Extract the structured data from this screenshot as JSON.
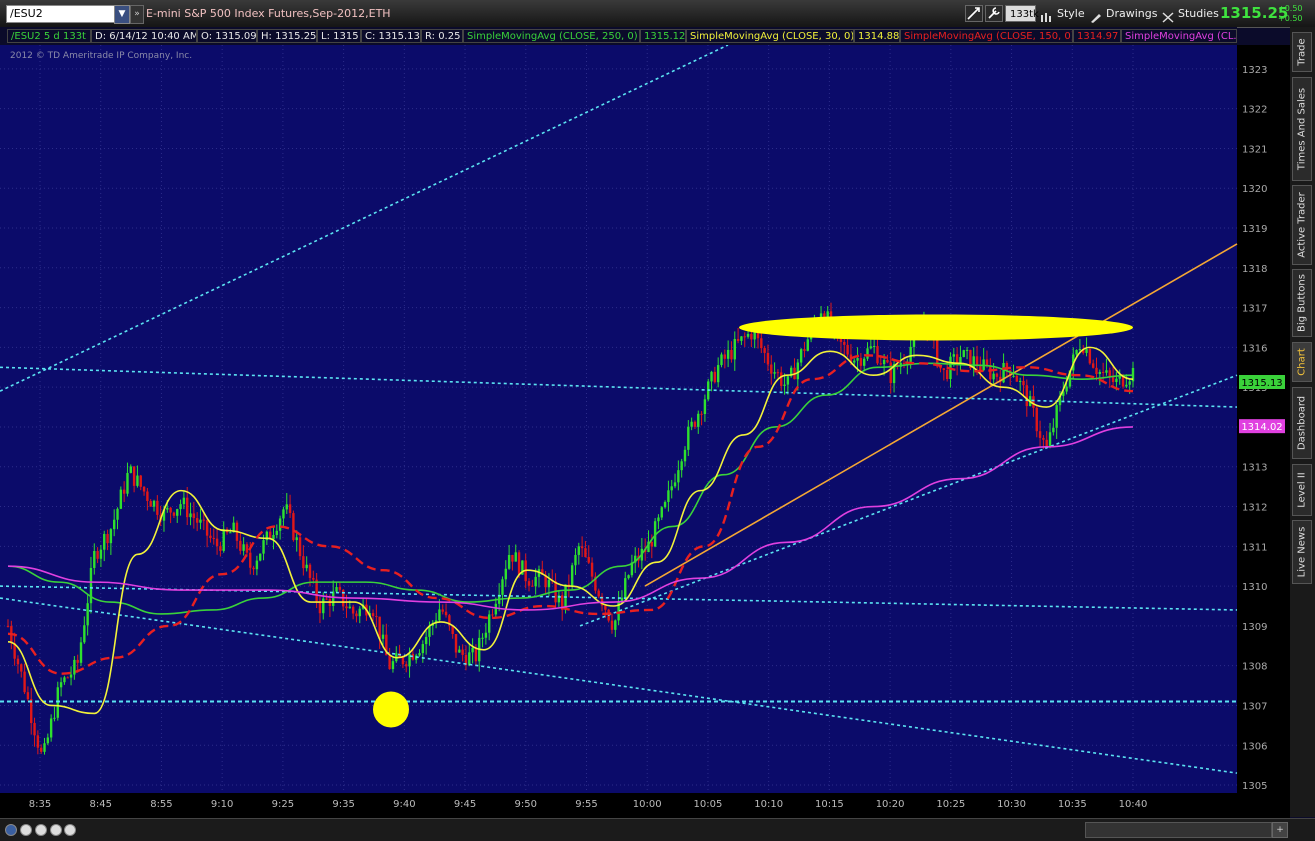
{
  "header": {
    "symbol": "/ESU2",
    "description": "E-mini S&P 500 Index Futures,Sep-2012,ETH",
    "aggregation_badge": "133tk",
    "style_label": "Style",
    "drawings_label": "Drawings",
    "studies_label": "Studies",
    "last_price": "1315.25",
    "change_top": "+0.50",
    "change_bottom": "+0.50"
  },
  "info_bar": {
    "aggregation": "/ESU2 5 d 133t",
    "datetime": "D: 6/14/12 10:40 AM",
    "open": "O: 1315.09",
    "high": "H: 1315.25",
    "low": "L: 1315",
    "close": "C: 1315.13",
    "range": "R: 0.25",
    "studies": [
      {
        "label": "SimpleMovingAvg (CLOSE, 250, 0)",
        "value": "1315.12",
        "color": "#3ad23a"
      },
      {
        "label": "SimpleMovingAvg (CLOSE, 30, 0)",
        "value": "1314.88",
        "color": "#f2f23a"
      },
      {
        "label": "SimpleMovingAvg (CLOSE, 150, 0)",
        "value": "1314.97",
        "color": "#e82020"
      },
      {
        "label": "SimpleMovingAvg (CL...",
        "value": "",
        "color": "#e040e0"
      }
    ]
  },
  "copyright": "2012 © TD Ameritrade IP Company, Inc.",
  "side_tabs": [
    "Trade",
    "Times And Sales",
    "Active Trader",
    "Big Buttons",
    "Chart",
    "Dashboard",
    "Level II",
    "Live News"
  ],
  "chart_data": {
    "type": "candlestick",
    "ylim": [
      1304.8,
      1323.6
    ],
    "yticks": [
      1305,
      1306,
      1307,
      1308,
      1309,
      1310,
      1311,
      1312,
      1313,
      1314,
      1315,
      1316,
      1317,
      1318,
      1319,
      1320,
      1321,
      1322,
      1323
    ],
    "xticks": [
      "8:35",
      "8:45",
      "8:55",
      "9:10",
      "9:25",
      "9:35",
      "9:40",
      "9:45",
      "9:50",
      "9:55",
      "10:00",
      "10:05",
      "10:10",
      "10:15",
      "10:20",
      "10:25",
      "10:30",
      "10:35",
      "10:40"
    ],
    "price_path": [
      1309,
      1307.4,
      1305.6,
      1307.5,
      1308,
      1310.8,
      1311.5,
      1312.9,
      1312.3,
      1311.8,
      1312.1,
      1311.6,
      1311,
      1311.4,
      1310.5,
      1311.2,
      1312,
      1310.7,
      1309.5,
      1309.8,
      1309.3,
      1309.6,
      1308,
      1308.2,
      1308.6,
      1309.5,
      1308.3,
      1308.2,
      1309.5,
      1310.9,
      1310.2,
      1310.2,
      1309.5,
      1311,
      1310,
      1309,
      1310.5,
      1311,
      1312,
      1313.5,
      1314.5,
      1315.5,
      1316,
      1316.4,
      1315.6,
      1315,
      1316,
      1317,
      1316.1,
      1315.7,
      1316,
      1315.3,
      1315.9,
      1316.7,
      1315.3,
      1315.8,
      1315.6,
      1315.3,
      1315.5,
      1314.6,
      1313.4,
      1315,
      1316.2,
      1315.4,
      1315.1,
      1315.4
    ],
    "series": [
      {
        "name": "SimpleMovingAvg (CLOSE, 250, 0)",
        "color": "#3ad23a",
        "style": "solid",
        "values": [
          1310.5,
          1310.1,
          1309.6,
          1309.3,
          1309.4,
          1309.7,
          1310.1,
          1310.1,
          1309.9,
          1309.6,
          1309.7,
          1309.9,
          1310.5,
          1311.5,
          1312.8,
          1314,
          1314.8,
          1315.5,
          1315.6,
          1315.55,
          1315.3,
          1315.2,
          1315.3
        ]
      },
      {
        "name": "SimpleMovingAvg (CLOSE, 30, 0)",
        "color": "#f2f23a",
        "style": "solid",
        "values": [
          1308.6,
          1307,
          1306.8,
          1310.8,
          1312.4,
          1311.4,
          1311.2,
          1309.6,
          1309.6,
          1308.2,
          1309.1,
          1308.4,
          1310.4,
          1310,
          1309.5,
          1310.6,
          1312.4,
          1313.8,
          1315.3,
          1315.9,
          1315.3,
          1315.8,
          1315.6,
          1315,
          1314.5,
          1316,
          1315.2
        ]
      },
      {
        "name": "SimpleMovingAvg (CLOSE, 150, 0)",
        "color": "#e82020",
        "style": "dashed",
        "values": [
          1308.8,
          1307.8,
          1308.2,
          1309,
          1310.3,
          1311.5,
          1311,
          1310.4,
          1309.7,
          1309.2,
          1309.5,
          1309.3,
          1309.4,
          1311,
          1313.5,
          1315.2,
          1315.8,
          1315.6,
          1315.4,
          1315.5,
          1315.3,
          1314.9
        ]
      },
      {
        "name": "SimpleMovingAvg (CL...",
        "color": "#e040e0",
        "style": "solid",
        "values": [
          1310.5,
          1310.1,
          1309.9,
          1309.9,
          1309.7,
          1309.6,
          1309.4,
          1309.6,
          1310.2,
          1311.1,
          1312,
          1312.7,
          1313.5,
          1314
        ]
      }
    ],
    "price_tags": [
      {
        "value": "1315.13",
        "color": "#3ad23a"
      },
      {
        "value": "1314.02",
        "color": "#e040e0"
      }
    ],
    "annotations": [
      {
        "type": "horizontal-line",
        "value": 1307.1,
        "color": "#5be3f2",
        "style": "dashed"
      },
      {
        "type": "ellipse-highlight",
        "center_price": 1316.5,
        "color": "#ffff00"
      },
      {
        "type": "circle-highlight",
        "center_price": 1306.9,
        "color": "#ffff00"
      }
    ]
  }
}
